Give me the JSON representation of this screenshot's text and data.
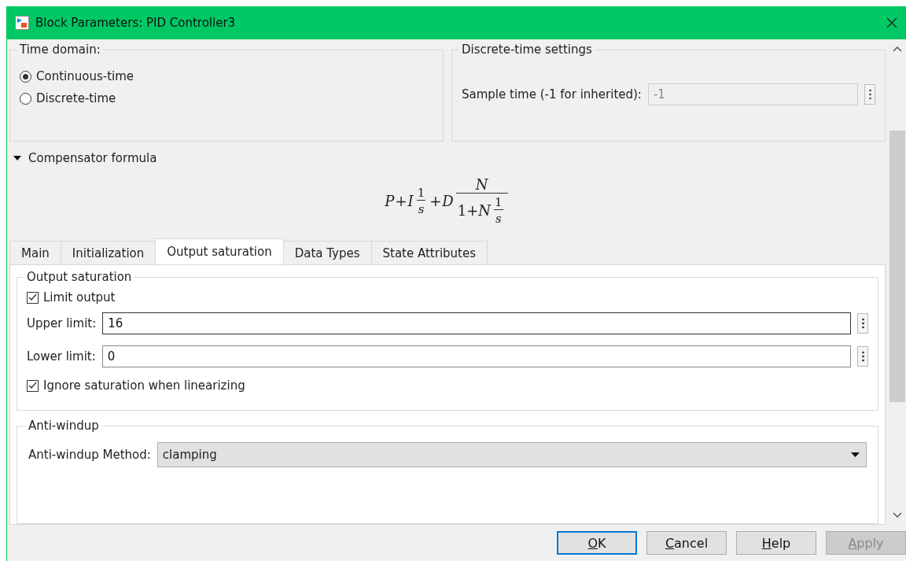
{
  "window": {
    "title": "Block Parameters: PID Controller3"
  },
  "time_domain": {
    "title": "Time domain:",
    "options": [
      {
        "label": "Continuous-time",
        "selected": true
      },
      {
        "label": "Discrete-time",
        "selected": false
      }
    ]
  },
  "discrete_settings": {
    "title": "Discrete-time settings",
    "sample_time": {
      "label": "Sample time (-1 for inherited):",
      "value": "-1",
      "disabled": true
    }
  },
  "compensator": {
    "title": "Compensator formula",
    "expanded": true,
    "formula": [
      {
        "kind": "sym",
        "text": "P"
      },
      {
        "kind": "op",
        "text": "+"
      },
      {
        "kind": "sym",
        "text": "I"
      },
      {
        "kind": "frac",
        "small": true,
        "num": [
          {
            "kind": "num",
            "text": "1"
          }
        ],
        "den": [
          {
            "kind": "sym",
            "text": "s"
          }
        ]
      },
      {
        "kind": "op",
        "text": "+"
      },
      {
        "kind": "sym",
        "text": "D"
      },
      {
        "kind": "frac",
        "small": false,
        "num": [
          {
            "kind": "sym",
            "text": "N"
          }
        ],
        "den": [
          {
            "kind": "num",
            "text": "1+"
          },
          {
            "kind": "sym",
            "text": "N"
          },
          {
            "kind": "frac",
            "small": true,
            "num": [
              {
                "kind": "num",
                "text": "1"
              }
            ],
            "den": [
              {
                "kind": "sym",
                "text": "s"
              }
            ]
          }
        ]
      }
    ]
  },
  "tabs": [
    {
      "label": "Main",
      "selected": false
    },
    {
      "label": "Initialization",
      "selected": false
    },
    {
      "label": "Output saturation",
      "selected": true
    },
    {
      "label": "Data Types",
      "selected": false
    },
    {
      "label": "State Attributes",
      "selected": false
    }
  ],
  "output_saturation": {
    "title": "Output saturation",
    "limit_output": {
      "label": "Limit output",
      "checked": true
    },
    "fields": [
      {
        "label": "Upper limit:",
        "value": "16",
        "focused": true
      },
      {
        "label": "Lower limit:",
        "value": "0",
        "focused": false
      }
    ],
    "ignore_saturation": {
      "label": "Ignore saturation when linearizing",
      "checked": true
    }
  },
  "anti_windup": {
    "title": "Anti-windup",
    "method": {
      "label": "Anti-windup Method:",
      "value": "clamping"
    }
  },
  "buttons": [
    {
      "label": "OK",
      "default": true,
      "disabled": false
    },
    {
      "label": "Cancel",
      "default": false,
      "disabled": false
    },
    {
      "label": "Help",
      "default": false,
      "disabled": false
    },
    {
      "label": "Apply",
      "default": false,
      "disabled": true
    }
  ]
}
